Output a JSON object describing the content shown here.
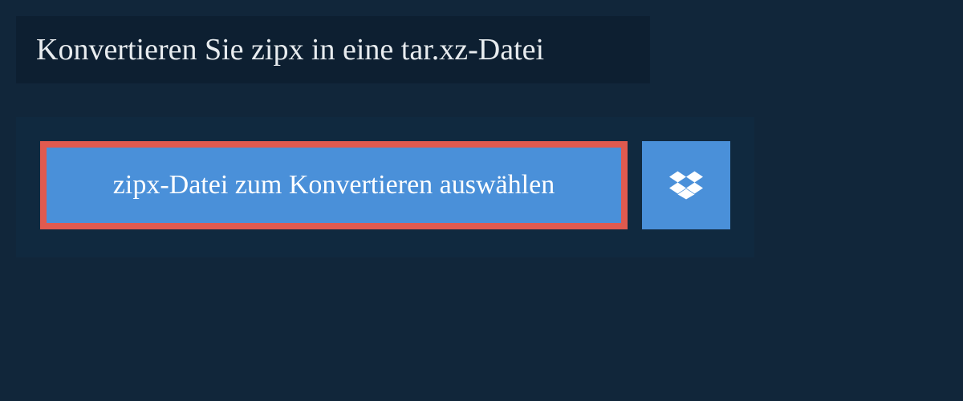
{
  "title": "Konvertieren Sie zipx in eine tar.xz-Datei",
  "upload": {
    "select_file_label": "zipx-Datei zum Konvertieren auswählen"
  },
  "colors": {
    "background": "#11263a",
    "panel_dark": "#0d1f31",
    "panel_medium": "#10293f",
    "button_blue": "#4a90d9",
    "highlight_border": "#e05a4f",
    "text_light": "#e8ecef"
  }
}
